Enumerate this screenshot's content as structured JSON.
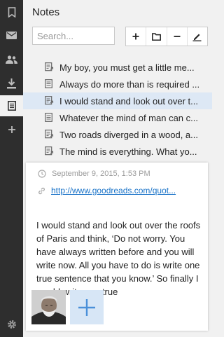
{
  "app": {
    "title": "Notes"
  },
  "search": {
    "placeholder": "Search..."
  },
  "toolbar": {
    "add_icon": "plus-icon",
    "folder_icon": "folder-icon",
    "remove_icon": "minus-icon",
    "edit_icon": "pencil-icon"
  },
  "rail": {
    "items": [
      {
        "icon": "bookmark-icon",
        "active": false
      },
      {
        "icon": "mail-icon",
        "active": false
      },
      {
        "icon": "people-icon",
        "active": false
      },
      {
        "icon": "download-icon",
        "active": false
      },
      {
        "icon": "note-icon",
        "active": true
      },
      {
        "icon": "plus-icon",
        "active": false
      }
    ],
    "settings_icon": "gear-icon"
  },
  "notes": [
    {
      "text": "My boy, you must get a little me...",
      "icon": "note-link-icon",
      "selected": false
    },
    {
      "text": "Always do more than is required ...",
      "icon": "note-icon",
      "selected": false
    },
    {
      "text": "I would stand and look out over t...",
      "icon": "note-link-icon",
      "selected": true
    },
    {
      "text": "Whatever the mind of man can c...",
      "icon": "note-icon",
      "selected": false
    },
    {
      "text": "Two roads diverged in a wood, a...",
      "icon": "note-link-icon",
      "selected": false
    },
    {
      "text": "The mind is everything. What yo...",
      "icon": "note-link-icon",
      "selected": false
    }
  ],
  "detail": {
    "date": "September 9, 2015, 1:53 PM",
    "url": "http://www.goodreads.com/quot...",
    "body": "I would stand and look out over the roofs of Paris and think, ‘Do not worry. You have always written before and you will write now. All you have to do is write one true sentence that you know.’ So finally I would write one true",
    "add_attachment_icon": "plus-icon"
  },
  "colors": {
    "rail_bg": "#2e2e2e",
    "selected_bg": "#dde8f5",
    "link": "#1a73c8",
    "accent": "#4a90d9"
  }
}
